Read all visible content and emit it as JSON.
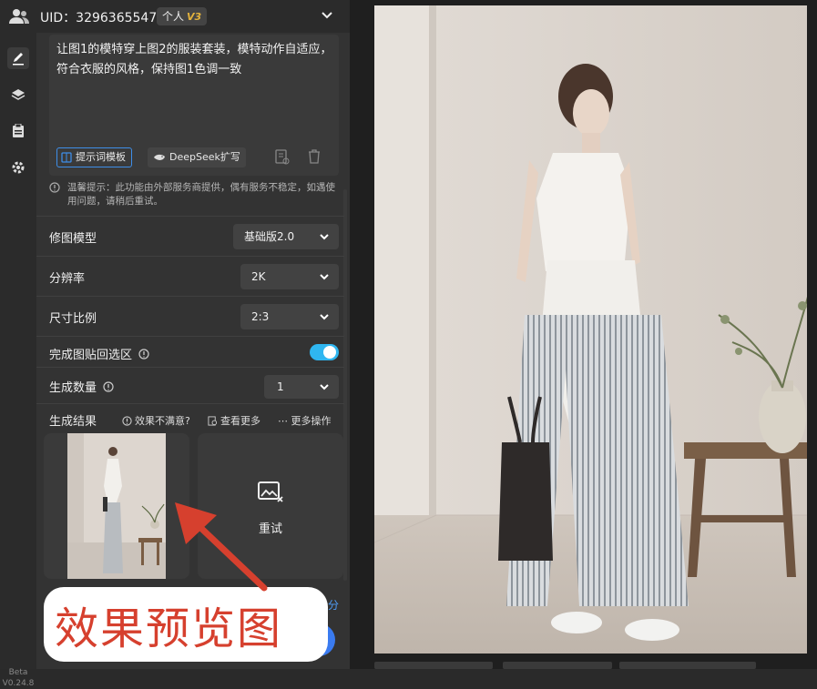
{
  "header": {
    "uid": "UID：3296365547",
    "badge_label": "个人",
    "badge_version": "V3"
  },
  "prompt": {
    "text": "让图1的模特穿上图2的服装套装，模特动作自适应，符合衣服的风格，保持图1色调一致",
    "template_button": "提示词模板",
    "deepseek_button": "DeepSeek扩写"
  },
  "notice": "温馨提示：此功能由外部服务商提供，偶有服务不稳定，如遇使用问题，请稍后重试。",
  "settings": {
    "model_label": "修图模型",
    "model_value": "基础版2.0",
    "resolution_label": "分辨率",
    "resolution_value": "2K",
    "ratio_label": "尺寸比例",
    "ratio_value": "2:3",
    "paste_label": "完成图贴回选区",
    "paste_enabled": true,
    "count_label": "生成数量",
    "count_value": "1"
  },
  "results": {
    "title": "生成结果",
    "unsatisfied": "效果不满意?",
    "view_more": "查看更多",
    "more_ops": "更多操作",
    "retry": "重试"
  },
  "bottom_hint_suffix": "分",
  "overlay_text": "效果预览图",
  "version": {
    "beta": "Beta",
    "number": "V0.24.8"
  },
  "colors": {
    "accent": "#3a7bf0",
    "toggle": "#2fb6f0",
    "annotation": "#d6402e"
  }
}
